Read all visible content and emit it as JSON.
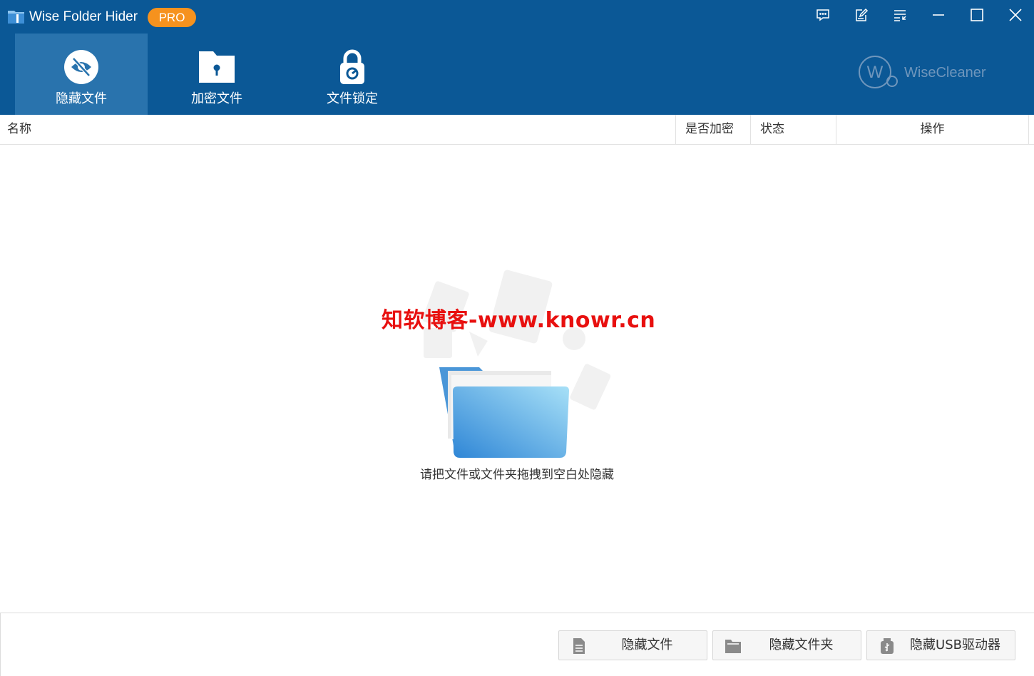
{
  "app": {
    "title": "Wise Folder Hider",
    "badge": "PRO"
  },
  "window_controls": [
    "feedback-icon",
    "edit-icon",
    "menu-icon",
    "minimize-icon",
    "maximize-icon",
    "close-icon"
  ],
  "tabs": [
    {
      "label": "隐藏文件",
      "icon": "eye-slash-icon",
      "active": true
    },
    {
      "label": "加密文件",
      "icon": "folder-keyhole-icon",
      "active": false
    },
    {
      "label": "文件锁定",
      "icon": "padlock-icon",
      "active": false
    }
  ],
  "brand": {
    "name": "WiseCleaner"
  },
  "table": {
    "columns": [
      "名称",
      "是否加密",
      "状态",
      "操作"
    ]
  },
  "empty_state": {
    "watermark": "知软博客-www.knowr.cn",
    "hint": "请把文件或文件夹拖拽到空白处隐藏"
  },
  "footer": {
    "buttons": [
      {
        "label": "隐藏文件",
        "icon": "document-icon"
      },
      {
        "label": "隐藏文件夹",
        "icon": "folder-icon"
      },
      {
        "label": "隐藏USB驱动器",
        "icon": "usb-drive-icon"
      }
    ]
  },
  "colors": {
    "header": "#0b5896",
    "active_tab": "#2973ad",
    "badge": "#f6921e",
    "watermark": "#e8100f"
  }
}
